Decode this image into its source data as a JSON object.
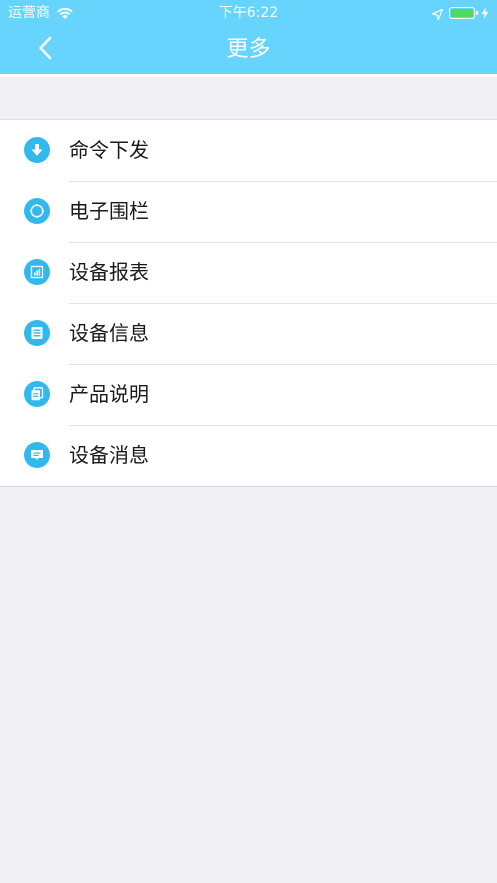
{
  "status_bar": {
    "carrier": "运营商",
    "time": "下午6:22"
  },
  "nav": {
    "title": "更多"
  },
  "menu": {
    "items": [
      {
        "label": "命令下发",
        "icon": "download-arrow-icon"
      },
      {
        "label": "电子围栏",
        "icon": "fence-circle-icon"
      },
      {
        "label": "设备报表",
        "icon": "report-chart-icon"
      },
      {
        "label": "设备信息",
        "icon": "info-list-icon"
      },
      {
        "label": "产品说明",
        "icon": "manual-document-icon"
      },
      {
        "label": "设备消息",
        "icon": "message-bubble-icon"
      }
    ]
  },
  "colors": {
    "header": "#66d4fc",
    "icon": "#31b9ee",
    "background": "#efeff4",
    "battery": "#4cd964"
  }
}
